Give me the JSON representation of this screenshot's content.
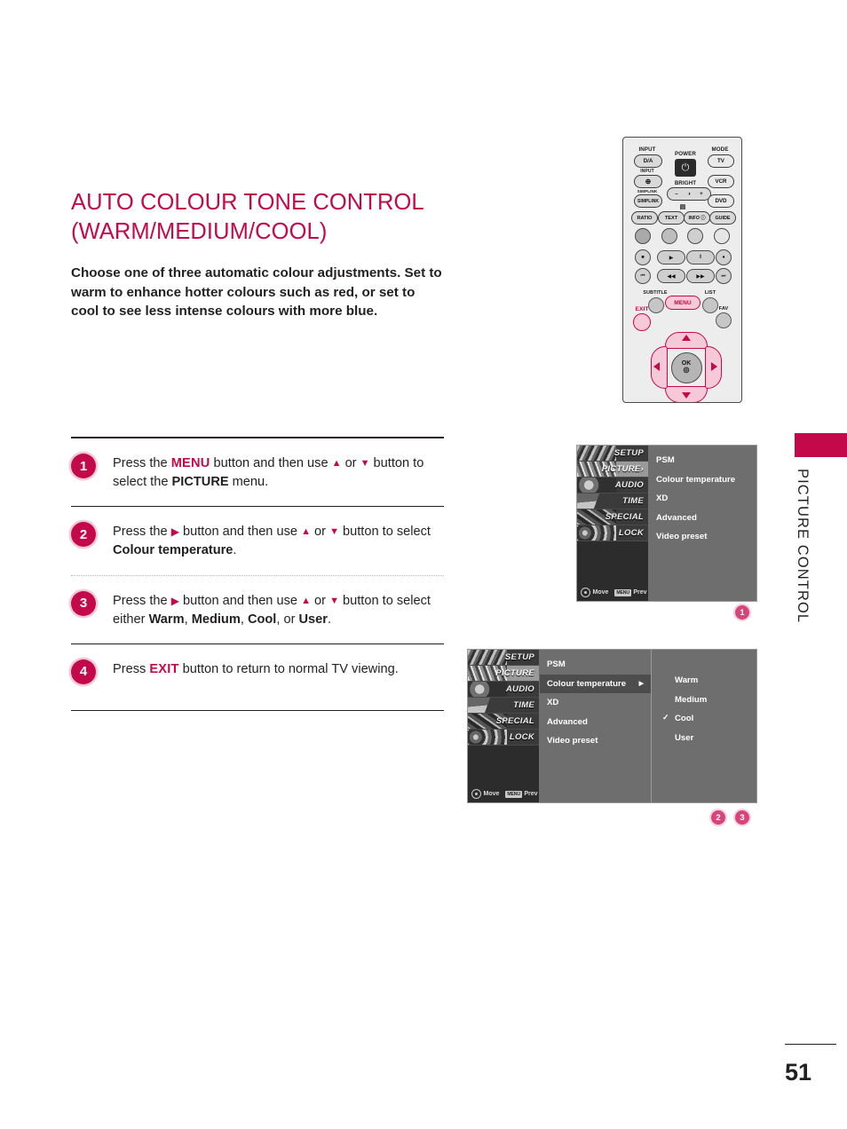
{
  "document": {
    "title_line1": "AUTO COLOUR TONE CONTROL",
    "title_line2": "(WARM/MEDIUM/COOL)",
    "intro": "Choose one of three automatic colour adjustments. Set to warm to enhance hotter colours such as red, or set to cool to see less intense colours with more blue.",
    "page_number": "51",
    "side_tab_label": "PICTURE CONTROL",
    "accent_color": "#c4094a"
  },
  "steps": [
    {
      "number": "1",
      "parts": [
        {
          "t": "Press the ",
          "style": "plain"
        },
        {
          "t": "MENU",
          "style": "kw"
        },
        {
          "t": " button and then use ",
          "style": "plain"
        },
        {
          "t": "▲",
          "style": "arrow"
        },
        {
          "t": " or ",
          "style": "plain"
        },
        {
          "t": "▼",
          "style": "arrow"
        },
        {
          "t": " button to select the ",
          "style": "plain"
        },
        {
          "t": "PICTURE",
          "style": "bold"
        },
        {
          "t": " menu.",
          "style": "plain"
        }
      ]
    },
    {
      "number": "2",
      "parts": [
        {
          "t": "Press the ",
          "style": "plain"
        },
        {
          "t": "▶",
          "style": "arrow"
        },
        {
          "t": " button and then use ",
          "style": "plain"
        },
        {
          "t": "▲",
          "style": "arrow"
        },
        {
          "t": " or ",
          "style": "plain"
        },
        {
          "t": "▼",
          "style": "arrow"
        },
        {
          "t": " button to select ",
          "style": "plain"
        },
        {
          "t": "Colour temperature",
          "style": "bold"
        },
        {
          "t": ".",
          "style": "plain"
        }
      ]
    },
    {
      "number": "3",
      "parts": [
        {
          "t": "Press the ",
          "style": "plain"
        },
        {
          "t": "▶",
          "style": "arrow"
        },
        {
          "t": " button and then use ",
          "style": "plain"
        },
        {
          "t": "▲",
          "style": "arrow"
        },
        {
          "t": " or ",
          "style": "plain"
        },
        {
          "t": "▼",
          "style": "arrow"
        },
        {
          "t": " button to select either ",
          "style": "plain"
        },
        {
          "t": "Warm",
          "style": "bold"
        },
        {
          "t": ", ",
          "style": "plain"
        },
        {
          "t": "Medium",
          "style": "bold"
        },
        {
          "t": ", ",
          "style": "plain"
        },
        {
          "t": "Cool",
          "style": "bold"
        },
        {
          "t": ", or ",
          "style": "plain"
        },
        {
          "t": "User",
          "style": "bold"
        },
        {
          "t": ".",
          "style": "plain"
        }
      ]
    },
    {
      "number": "4",
      "parts": [
        {
          "t": "Press ",
          "style": "plain"
        },
        {
          "t": "EXIT",
          "style": "kw"
        },
        {
          "t": " button to return to normal TV viewing.",
          "style": "plain"
        }
      ]
    }
  ],
  "remote": {
    "labels": {
      "input1": "INPUT",
      "input2": "INPUT",
      "mode": "MODE",
      "power": "POWER",
      "bright": "BRIGHT",
      "simplink_small": "SIMPLINK",
      "subtitle": "SUBTITLE",
      "list": "LIST",
      "fav": "FAV"
    },
    "buttons": {
      "da": "D/A",
      "input_plus": "⊕",
      "simplink": "SIMPLINK",
      "tv": "TV",
      "vcr": "VCR",
      "dvd": "DVD",
      "bright_minus": "–",
      "bright_icon": "◑",
      "bright_plus": "+",
      "ratio": "RATIO",
      "text": "TEXT",
      "info": "INFO ⓘ",
      "guide": "GUIDE",
      "menu": "MENU",
      "exit": "EXIT",
      "ok": "OK",
      "power_icon": "⏻",
      "text_above": "▤",
      "stop": "■",
      "play": "▶",
      "pause": "‖",
      "record": "●",
      "prev": "⏮",
      "rew": "◀◀",
      "ffwd": "▶▶",
      "next": "⏭"
    }
  },
  "osd1": {
    "sidebar": [
      "SETUP",
      "PICTURE",
      "AUDIO",
      "TIME",
      "SPECIAL",
      "LOCK"
    ],
    "selected_sidebar": "PICTURE",
    "items": [
      "PSM",
      "Colour temperature",
      "XD",
      "Advanced",
      "Video preset"
    ],
    "footer": {
      "move": "Move",
      "menu_chip": "MENU",
      "prev": "Prev"
    },
    "marker": "1"
  },
  "osd2": {
    "sidebar": [
      "SETUP",
      "PICTURE",
      "AUDIO",
      "TIME",
      "SPECIAL",
      "LOCK"
    ],
    "selected_sidebar": "PICTURE",
    "items": [
      "PSM",
      "Colour temperature",
      "XD",
      "Advanced",
      "Video preset"
    ],
    "highlighted_item": "Colour temperature",
    "submenu": [
      "Warm",
      "Medium",
      "Cool",
      "User"
    ],
    "checked_submenu": "Cool",
    "footer": {
      "move": "Move",
      "menu_chip": "MENU",
      "prev": "Prev"
    },
    "markers": [
      "2",
      "3"
    ]
  }
}
